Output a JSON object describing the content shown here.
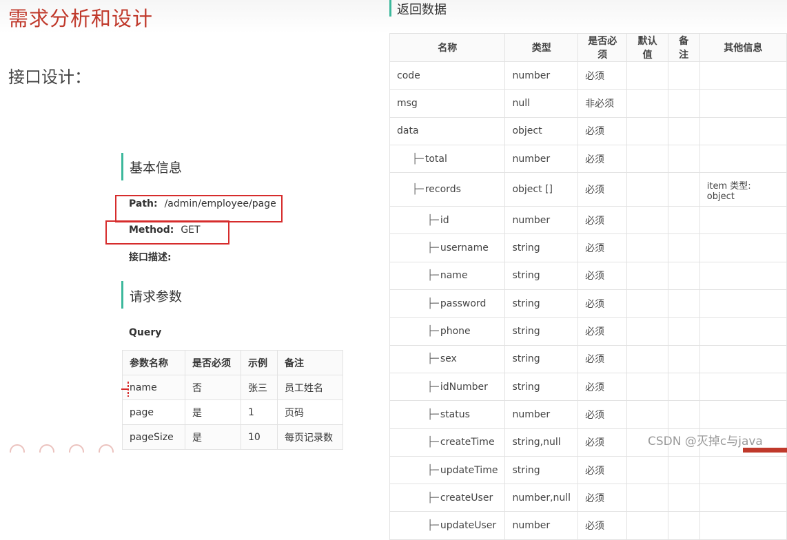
{
  "slide": {
    "title": "需求分析和设计",
    "section": "接口设计："
  },
  "basic_info": {
    "heading": "基本信息",
    "path_label": "Path:",
    "path_value": "/admin/employee/page",
    "method_label": "Method:",
    "method_value": "GET",
    "desc_label": "接口描述:"
  },
  "request_params": {
    "heading": "请求参数",
    "query_label": "Query",
    "headers": [
      "参数名称",
      "是否必须",
      "示例",
      "备注"
    ],
    "rows": [
      [
        "name",
        "否",
        "张三",
        "员工姓名"
      ],
      [
        "page",
        "是",
        "1",
        "页码"
      ],
      [
        "pageSize",
        "是",
        "10",
        "每页记录数"
      ]
    ]
  },
  "response": {
    "heading": "返回数据",
    "headers": [
      "名称",
      "类型",
      "是否必须",
      "默认值",
      "备注",
      "其他信息"
    ],
    "rows": [
      {
        "prefix": "",
        "name": "code",
        "type": "number",
        "required": "必须",
        "default": "",
        "note": "",
        "other": ""
      },
      {
        "prefix": "",
        "name": "msg",
        "type": "null",
        "required": "非必须",
        "default": "",
        "note": "",
        "other": ""
      },
      {
        "prefix": "",
        "name": "data",
        "type": "object",
        "required": "必须",
        "default": "",
        "note": "",
        "other": ""
      },
      {
        "prefix": "├─",
        "name": "total",
        "type": "number",
        "required": "必须",
        "default": "",
        "note": "",
        "other": ""
      },
      {
        "prefix": "├─",
        "name": "records",
        "type": "object []",
        "required": "必须",
        "default": "",
        "note": "",
        "other": "item 类型: object"
      },
      {
        "prefix": "├─",
        "name": "id",
        "type": "number",
        "required": "必须",
        "default": "",
        "note": "",
        "other": ""
      },
      {
        "prefix": "├─",
        "name": "username",
        "type": "string",
        "required": "必须",
        "default": "",
        "note": "",
        "other": ""
      },
      {
        "prefix": "├─",
        "name": "name",
        "type": "string",
        "required": "必须",
        "default": "",
        "note": "",
        "other": ""
      },
      {
        "prefix": "├─",
        "name": "password",
        "type": "string",
        "required": "必须",
        "default": "",
        "note": "",
        "other": ""
      },
      {
        "prefix": "├─",
        "name": "phone",
        "type": "string",
        "required": "必须",
        "default": "",
        "note": "",
        "other": ""
      },
      {
        "prefix": "├─",
        "name": "sex",
        "type": "string",
        "required": "必须",
        "default": "",
        "note": "",
        "other": ""
      },
      {
        "prefix": "├─",
        "name": "idNumber",
        "type": "string",
        "required": "必须",
        "default": "",
        "note": "",
        "other": ""
      },
      {
        "prefix": "├─",
        "name": "status",
        "type": "number",
        "required": "必须",
        "default": "",
        "note": "",
        "other": ""
      },
      {
        "prefix": "├─",
        "name": "createTime",
        "type": "string,null",
        "required": "必须",
        "default": "",
        "note": "",
        "other": ""
      },
      {
        "prefix": "├─",
        "name": "updateTime",
        "type": "string",
        "required": "必须",
        "default": "",
        "note": "",
        "other": ""
      },
      {
        "prefix": "├─",
        "name": "createUser",
        "type": "number,null",
        "required": "必须",
        "default": "",
        "note": "",
        "other": ""
      },
      {
        "prefix": "├─",
        "name": "updateUser",
        "type": "number",
        "required": "必须",
        "default": "",
        "note": "",
        "other": ""
      }
    ]
  },
  "watermark": "CSDN @灭掉c与java",
  "colors": {
    "title_red": "#c0392b",
    "accent_green": "#3cb89c",
    "highlight_box": "#d62c2c"
  }
}
